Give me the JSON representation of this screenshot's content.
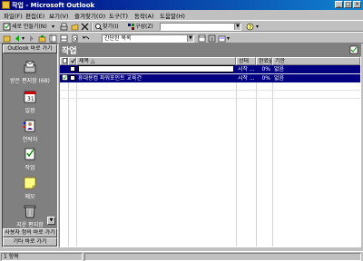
{
  "window": {
    "title": "작업 - Microsoft Outlook"
  },
  "menu": [
    "파일(F)",
    "편집(E)",
    "보기(V)",
    "즐겨찾기(O)",
    "도구(T)",
    "동작(A)",
    "도움말(H)"
  ],
  "toolbar1": {
    "new_label": "새로 만들기(N)",
    "find_label": "찾기(I)",
    "organize_label": "구성(Z)"
  },
  "toolbar2": {
    "view_combo": "간단한 목록"
  },
  "outlook_bar": {
    "top_group": "Outlook 바로 가기",
    "shortcuts": [
      {
        "label": "받은 편지함 (68)",
        "icon": "inbox-icon"
      },
      {
        "label": "일정",
        "icon": "calendar-icon"
      },
      {
        "label": "연락처",
        "icon": "contacts-icon"
      },
      {
        "label": "작업",
        "icon": "tasks-icon"
      },
      {
        "label": "메모",
        "icon": "notes-icon"
      },
      {
        "label": "지운 편지함",
        "icon": "deleted-items-icon"
      }
    ],
    "group2": "사용자 정의 바로 가기",
    "group3": "기타 바로 가기"
  },
  "folder": {
    "name": "작업"
  },
  "columns": {
    "subject": "제목",
    "status": "상태",
    "percent": "완료율",
    "due": "기한"
  },
  "new_row": {
    "status": "시작 ...",
    "percent": "0%",
    "due": "없음"
  },
  "tasks": [
    {
      "subject": "휴대용컴 파워포인트 교육건",
      "status": "시작 ...",
      "percent": "0%",
      "due": "없음"
    }
  ],
  "status": {
    "count": "1 항목"
  }
}
